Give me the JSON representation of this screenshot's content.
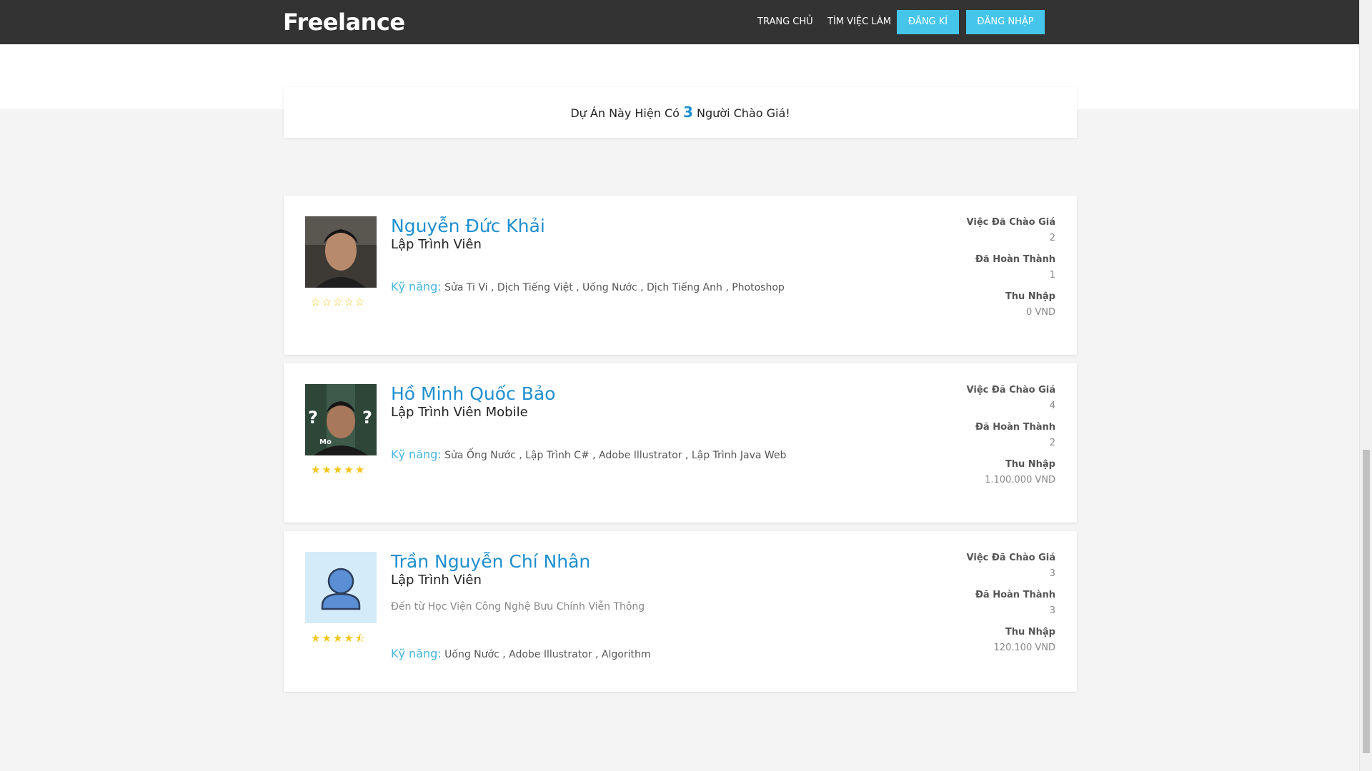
{
  "nav": {
    "brand": "Freelance",
    "home": "TRANG CHỦ",
    "jobs": "TÌM VIỆC LÀM",
    "register": "ĐĂNG KÍ",
    "login": "ĐĂNG NHẬP"
  },
  "summary": {
    "prefix": "Dự Án Này Hiện Có",
    "count": "3",
    "suffix": "Người Chào Giá!"
  },
  "labels": {
    "skills": "Kỹ năng:",
    "bids": "Việc Đã Chào Giá",
    "completed": "Đã Hoàn Thành",
    "income": "Thu Nhập"
  },
  "freelancers": [
    {
      "name": "Nguyễn Đức Khải",
      "title": "Lập Trình Viên",
      "rating": 0,
      "skills": "Sửa Ti Vi , Dịch Tiếng Việt , Uống Nước , Dịch Tiếng Anh , Photoshop",
      "bids": "2",
      "completed": "1",
      "income": "0 VND"
    },
    {
      "name": "Hồ Minh Quốc Bảo",
      "title": "Lập Trình Viên Mobile",
      "rating": 5,
      "skills": "Sửa Ống Nước , Lập Trình C# , Adobe Illustrator , Lập Trình Java Web",
      "bids": "4",
      "completed": "2",
      "income": "1.100.000 VND"
    },
    {
      "name": "Trần Nguyễn Chí Nhân",
      "title": "Lập Trình Viên",
      "school": "Đến từ Học Viện Công Nghệ Bưu Chính Viễn Thông",
      "rating": 4.5,
      "skills": "Uống Nước , Adobe Illustrator , Algorithm",
      "bids": "3",
      "completed": "3",
      "income": "120.100 VND"
    }
  ],
  "colors": {
    "navbar": "#333333",
    "accent": "#45c5ea",
    "name_link": "#1e8fd0",
    "star": "#f5c518"
  }
}
